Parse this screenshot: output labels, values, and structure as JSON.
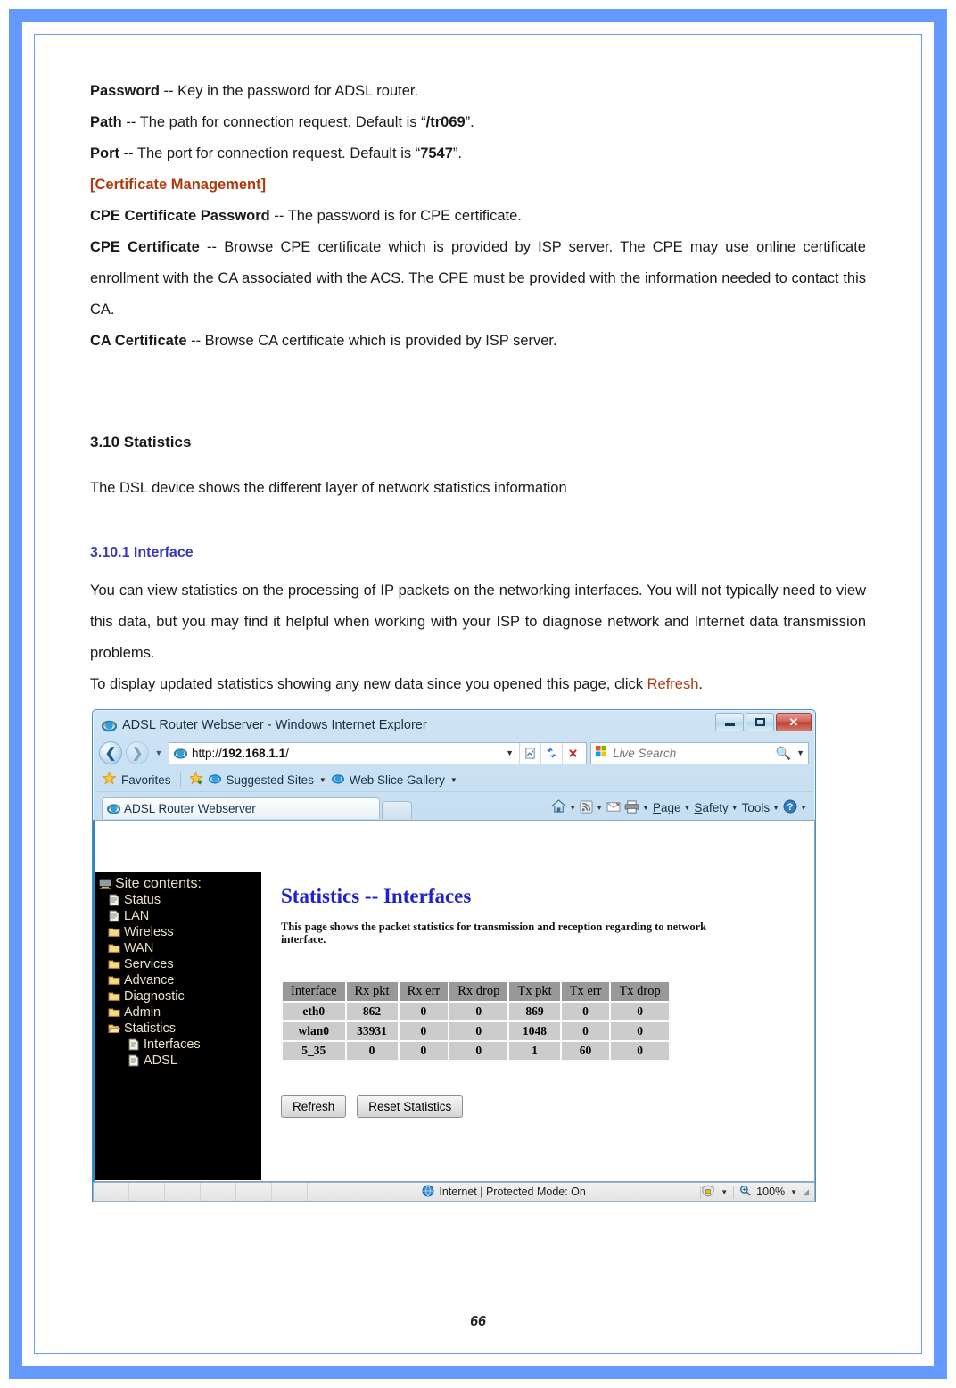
{
  "document": {
    "page_number": "66",
    "paragraphs": [
      {
        "id": "password",
        "term": "Password",
        "rest": " -- Key in the password for ADSL router."
      },
      {
        "id": "path",
        "term": "Path",
        "rest": " -- The path for connection request. Default is ",
        "emph": "/tr069",
        "tail": "."
      },
      {
        "id": "port",
        "term": "Port",
        "rest": " -- The port for connection request. Default is ",
        "emph": "7547",
        "tail": "."
      }
    ],
    "cert_heading": "[Certificate Management]",
    "cert_items": [
      {
        "term": "CPE Certificate Password",
        "rest": " -- The password is for CPE certificate."
      },
      {
        "term": "CPE Certificate",
        "rest": " -- Browse CPE certificate which is provided by ISP server. The CPE may use online certificate enrollment with the CA associated with the ACS. The CPE must be provided with the information needed to contact this CA."
      },
      {
        "term": "CA Certificate",
        "rest": " -- Browse CA certificate which is provided by ISP server."
      }
    ],
    "section": {
      "heading": "3.10 Statistics",
      "intro": "The DSL device shows the different layer of network statistics information",
      "subheading": "3.10.1 Interface",
      "body1": "You can view statistics on the processing of IP packets on the networking interfaces. You will not typically need to view this data, but you may find it helpful when working with your ISP to diagnose network and Internet data transmission problems.",
      "body2_pre": "To display updated statistics showing any new data since you opened this page, click ",
      "body2_link": "Refresh",
      "body2_post": "."
    },
    "quote_open": "“",
    "quote_close": "”"
  },
  "browser": {
    "title": "ADSL Router Webserver - Windows Internet Explorer",
    "window_buttons": {
      "minimize": "Minimize",
      "maximize": "Maximize",
      "close": "✕"
    },
    "address": {
      "url_scheme": "http://",
      "url_host": "192.168.1.1",
      "url_path": "/"
    },
    "search": {
      "placeholder": "Live Search"
    },
    "favorites_bar": {
      "favorites": "Favorites",
      "suggested_sites": "Suggested Sites",
      "web_slice_gallery": "Web Slice Gallery"
    },
    "tab": {
      "label": "ADSL Router Webserver"
    },
    "command_bar": [
      "Page",
      "Safety",
      "Tools"
    ],
    "status": {
      "zone": "Internet | Protected Mode: On",
      "zoom": "100%"
    }
  },
  "webpage": {
    "site_contents_label": "Site contents:",
    "nav_items": [
      {
        "label": "Status",
        "icon": "page-icon",
        "level": 1
      },
      {
        "label": "LAN",
        "icon": "page-icon",
        "level": 1
      },
      {
        "label": "Wireless",
        "icon": "folder-icon",
        "level": 1
      },
      {
        "label": "WAN",
        "icon": "folder-icon",
        "level": 1
      },
      {
        "label": "Services",
        "icon": "folder-icon",
        "level": 1
      },
      {
        "label": "Advance",
        "icon": "folder-icon",
        "level": 1
      },
      {
        "label": "Diagnostic",
        "icon": "folder-icon",
        "level": 1
      },
      {
        "label": "Admin",
        "icon": "folder-icon",
        "level": 1
      },
      {
        "label": "Statistics",
        "icon": "folder-open-icon",
        "level": 1
      },
      {
        "label": "Interfaces",
        "icon": "page-icon",
        "level": 2
      },
      {
        "label": "ADSL",
        "icon": "page-icon",
        "level": 2
      }
    ],
    "title": "Statistics -- Interfaces",
    "description": "This page shows the packet statistics for transmission and reception regarding to network interface.",
    "table": {
      "headers": [
        "Interface",
        "Rx pkt",
        "Rx err",
        "Rx drop",
        "Tx pkt",
        "Tx err",
        "Tx drop"
      ],
      "rows": [
        [
          "eth0",
          "862",
          "0",
          "0",
          "869",
          "0",
          "0"
        ],
        [
          "wlan0",
          "33931",
          "0",
          "0",
          "1048",
          "0",
          "0"
        ],
        [
          "5_35",
          "0",
          "0",
          "0",
          "1",
          "60",
          "0"
        ]
      ]
    },
    "buttons": {
      "refresh": "Refresh",
      "reset": "Reset Statistics"
    }
  },
  "colors": {
    "page_border": "#6699ff",
    "accent_orange": "#b03a10",
    "accent_blue": "#3a3ab0",
    "web_title_blue": "#2020d0",
    "table_header_bg": "#999999",
    "table_cell_bg": "#cccccc"
  }
}
